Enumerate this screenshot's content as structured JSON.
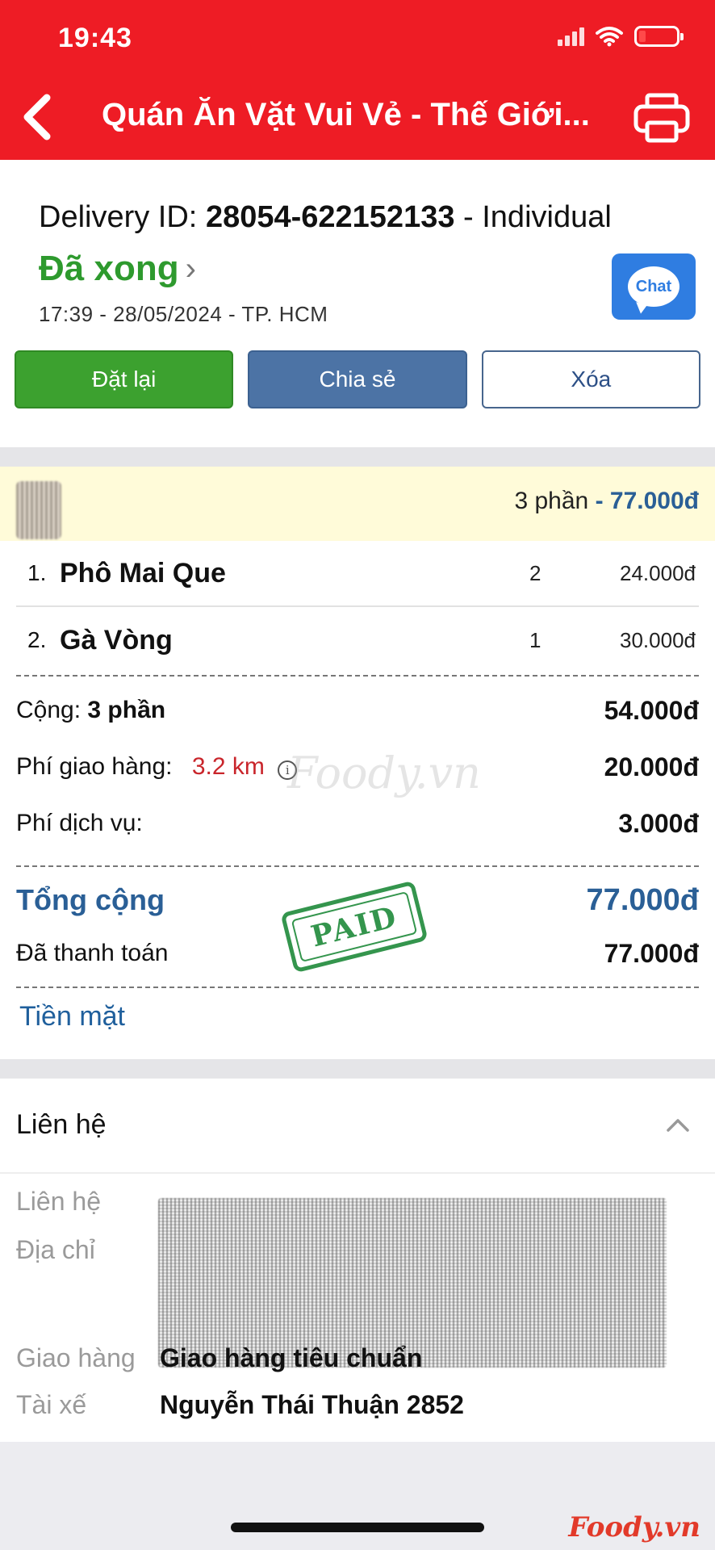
{
  "status_bar": {
    "time": "19:43"
  },
  "header": {
    "title": "Quán Ăn Vặt Vui Vẻ - Thế Giới..."
  },
  "order": {
    "delivery_label": "Delivery ID:",
    "delivery_id": "28054-622152133",
    "delivery_type": "- Individual",
    "status": "Đã xong",
    "meta": "17:39 - 28/05/2024 - TP. HCM",
    "chat_label": "Chat"
  },
  "actions": {
    "reorder": "Đặt lại",
    "share": "Chia sẻ",
    "delete": "Xóa"
  },
  "summary": {
    "portions": "3 phần",
    "total": "- 77.000đ"
  },
  "items": [
    {
      "index": "1.",
      "name": "Phô Mai Que",
      "qty": "2",
      "price": "24.000đ"
    },
    {
      "index": "2.",
      "name": "Gà Vòng",
      "qty": "1",
      "price": "30.000đ"
    }
  ],
  "totals": {
    "subtotal_label_prefix": "Cộng:",
    "subtotal_label_count": "3 phần",
    "subtotal_value": "54.000đ",
    "shipping_label": "Phí giao hàng:",
    "shipping_distance": "3.2 km",
    "shipping_value": "20.000đ",
    "service_label": "Phí dịch vụ:",
    "service_value": "3.000đ",
    "grand_label": "Tổng cộng",
    "grand_value": "77.000đ",
    "paid_label": "Đã thanh toán",
    "paid_value": "77.000đ",
    "payment_method": "Tiền mặt",
    "stamp": "PAID",
    "watermark": "Foody.vn"
  },
  "contact": {
    "title": "Liên hệ",
    "contact_label": "Liên hệ",
    "address_label": "Địa chỉ",
    "delivery_label": "Giao hàng",
    "delivery_value": "Giao hàng tiêu chuẩn",
    "driver_label": "Tài xế",
    "driver_value": "Nguyễn Thái Thuận 2852"
  },
  "footer": {
    "brand": "Foody.vn"
  },
  "colors": {
    "header_red": "#ee1c25",
    "status_green": "#2e9a2e",
    "accent_blue": "#2a5f96",
    "distance_red": "#c9252b"
  }
}
